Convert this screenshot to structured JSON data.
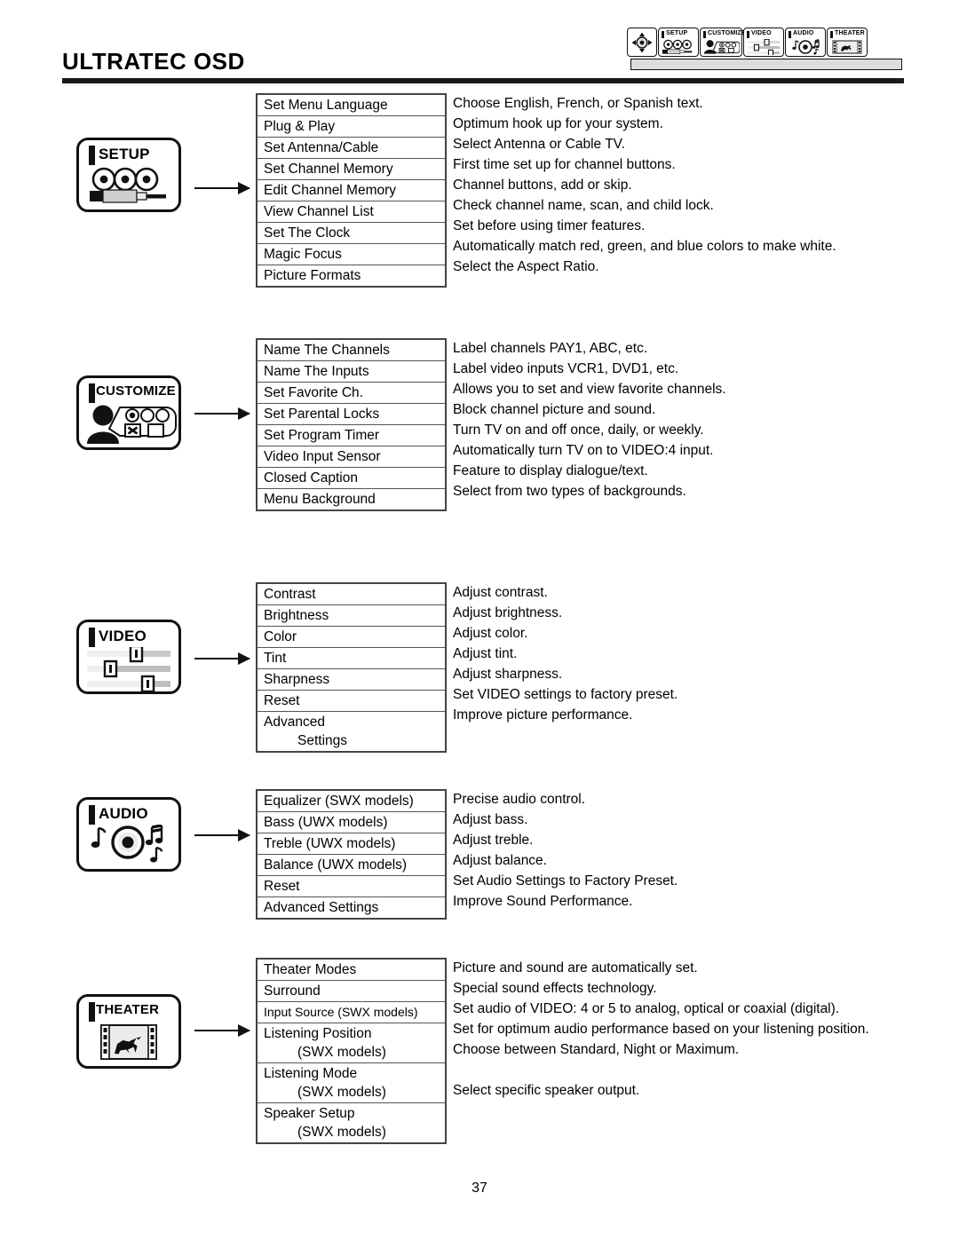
{
  "header": {
    "title": "ULTRATEC OSD",
    "tabs": [
      {
        "label": "",
        "icon": "dpad-icon"
      },
      {
        "label": "SETUP",
        "icon": "setup-icon"
      },
      {
        "label": "CUSTOMIZE",
        "icon": "customize-icon"
      },
      {
        "label": "VIDEO",
        "icon": "video-icon"
      },
      {
        "label": "AUDIO",
        "icon": "audio-icon"
      },
      {
        "label": "THEATER",
        "icon": "theater-icon"
      }
    ]
  },
  "sections": [
    {
      "key": "setup",
      "icon_label": "SETUP",
      "icon": "setup-icon",
      "rows": [
        {
          "label": "Set Menu Language",
          "desc": "Choose English, French, or Spanish text."
        },
        {
          "label": "Plug & Play",
          "desc": "Optimum hook up for your system."
        },
        {
          "label": "Set Antenna/Cable",
          "desc": "Select Antenna or Cable TV."
        },
        {
          "label": "Set Channel Memory",
          "desc": "First time set up for channel buttons."
        },
        {
          "label": "Edit Channel Memory",
          "desc": "Channel buttons, add or skip."
        },
        {
          "label": "View Channel List",
          "desc": "Check channel name, scan, and child lock."
        },
        {
          "label": "Set The Clock",
          "desc": "Set before using timer features."
        },
        {
          "label": "Magic Focus",
          "desc": "Automatically match red, green, and blue colors to make white."
        },
        {
          "label": "Picture Formats",
          "desc": "Select  the Aspect Ratio."
        }
      ]
    },
    {
      "key": "customize",
      "icon_label": "CUSTOMIZE",
      "icon": "customize-icon",
      "rows": [
        {
          "label": "Name The Channels",
          "desc": "Label channels PAY1, ABC, etc."
        },
        {
          "label": "Name The Inputs",
          "desc": "Label video inputs VCR1, DVD1, etc."
        },
        {
          "label": "Set Favorite Ch.",
          "desc": "Allows you to set and view favorite channels."
        },
        {
          "label": "Set Parental Locks",
          "desc": "Block channel picture and sound."
        },
        {
          "label": "Set Program Timer",
          "desc": "Turn TV on and off once, daily, or weekly."
        },
        {
          "label": "Video Input Sensor",
          "desc": "Automatically turn TV on to VIDEO:4 input."
        },
        {
          "label": "Closed Caption",
          "desc": "Feature to display dialogue/text."
        },
        {
          "label": "Menu Background",
          "desc": "Select from two types of backgrounds."
        }
      ]
    },
    {
      "key": "video",
      "icon_label": "VIDEO",
      "icon": "video-icon",
      "rows": [
        {
          "label": "Contrast",
          "desc": "Adjust contrast."
        },
        {
          "label": "Brightness",
          "desc": "Adjust brightness."
        },
        {
          "label": "Color",
          "desc": "Adjust color."
        },
        {
          "label": "Tint",
          "desc": "Adjust tint."
        },
        {
          "label": "Sharpness",
          "desc": "Adjust sharpness."
        },
        {
          "label": "Reset",
          "desc": "Set VIDEO settings to factory preset."
        },
        {
          "label": "Advanced",
          "sub": "Settings",
          "desc": "Improve picture performance."
        }
      ]
    },
    {
      "key": "audio",
      "icon_label": "AUDIO",
      "icon": "audio-icon",
      "rows": [
        {
          "label": "Equalizer (SWX models)",
          "desc": "Precise audio control."
        },
        {
          "label": "Bass (UWX models)",
          "desc": "Adjust bass."
        },
        {
          "label": "Treble (UWX models)",
          "desc": "Adjust treble."
        },
        {
          "label": "Balance (UWX models)",
          "desc": "Adjust balance."
        },
        {
          "label": "Reset",
          "desc": "Set Audio Settings to Factory Preset."
        },
        {
          "label": "Advanced Settings",
          "desc": "Improve Sound Performance."
        }
      ]
    },
    {
      "key": "theater",
      "icon_label": "THEATER",
      "icon": "theater-icon",
      "rows": [
        {
          "label": "Theater Modes",
          "desc": "Picture and sound are automatically set."
        },
        {
          "label": "Surround",
          "desc": "Special sound effects technology."
        },
        {
          "label": "Input Source (SWX models)",
          "desc": "Set audio of VIDEO: 4 or 5 to analog, optical or coaxial (digital)."
        },
        {
          "label": "Listening Position",
          "sub": "(SWX models)",
          "desc": "Set for optimum audio performance based on your listening position."
        },
        {
          "label": "Listening Mode",
          "sub": "(SWX models)",
          "desc": "Choose between Standard, Night or Maximum."
        },
        {
          "label": "Speaker Setup",
          "sub": "(SWX models)",
          "desc": "Select specific speaker output."
        }
      ]
    }
  ],
  "footer": {
    "page_number": "37"
  }
}
